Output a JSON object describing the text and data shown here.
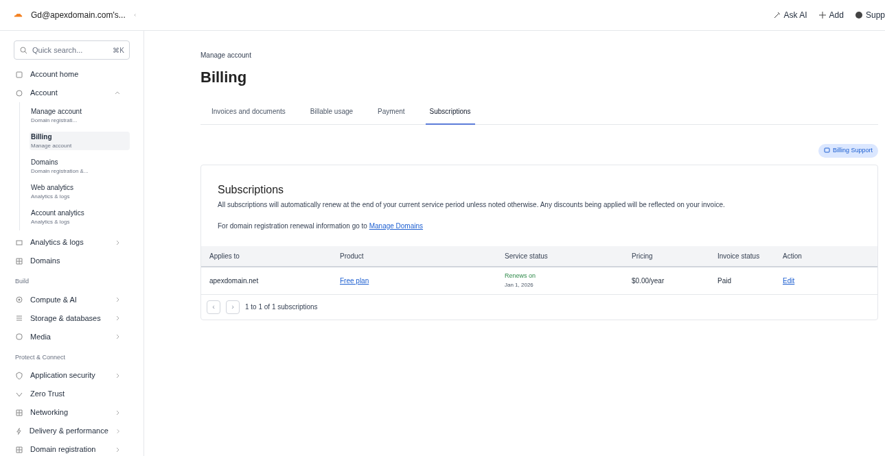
{
  "account": {
    "name": "Gd@apexdomain.com's..."
  },
  "top_actions": [
    {
      "kind": "ai",
      "label": "Ask AI"
    },
    {
      "kind": "add",
      "label": "Add"
    },
    {
      "kind": "support",
      "label": "Supp"
    }
  ],
  "search": {
    "placeholder": "Quick search...",
    "shortcut": "⌘K"
  },
  "sidebar": [
    {
      "kind": "item",
      "label": "Account home"
    },
    {
      "kind": "item",
      "label": "Account",
      "expanded": true,
      "children": [
        {
          "label": "Manage account",
          "sub": "Domain registrati...",
          "selected": false
        },
        {
          "label": "Billing",
          "sub": "Manage account",
          "selected": true
        },
        {
          "label": "Domains",
          "sub": "Domain registration &...",
          "selected": false
        },
        {
          "label": "Web analytics",
          "sub": "Analytics & logs",
          "selected": false
        },
        {
          "label": "Account analytics",
          "sub": "Analytics & logs",
          "selected": false
        }
      ]
    },
    {
      "kind": "item",
      "label": "Analytics & logs",
      "expanded": false
    },
    {
      "kind": "item",
      "label": "Domains"
    },
    {
      "kind": "section",
      "label": "Build"
    },
    {
      "kind": "item",
      "label": "Compute & AI",
      "expanded": false
    },
    {
      "kind": "item",
      "label": "Storage & databases",
      "expanded": false
    },
    {
      "kind": "item",
      "label": "Media",
      "expanded": false
    },
    {
      "kind": "section",
      "label": "Protect & Connect"
    },
    {
      "kind": "item",
      "label": "Application security",
      "expanded": false
    },
    {
      "kind": "item",
      "label": "Zero Trust"
    },
    {
      "kind": "item",
      "label": "Networking",
      "expanded": false
    },
    {
      "kind": "item",
      "label": "Delivery & performance",
      "expanded": false
    },
    {
      "kind": "item",
      "label": "Domain registration",
      "expanded": false
    }
  ],
  "breadcrumb": "Manage account",
  "title": "Billing",
  "tabs": [
    {
      "label": "Invoices and documents",
      "selected": false
    },
    {
      "label": "Billable usage",
      "selected": false
    },
    {
      "label": "Payment",
      "selected": false
    },
    {
      "label": "Subscriptions",
      "selected": true
    }
  ],
  "support_button": "Billing Support",
  "card": {
    "title": "Subscriptions",
    "text": "All subscriptions will automatically renew at the end of your current service period unless noted otherwise. Any discounts being applied will be reflected on your invoice.",
    "note": "For domain registration renewal information go to",
    "note_link": "Manage Domains",
    "columns": [
      "Applies to",
      "Product",
      "Service status",
      "Pricing",
      "Invoice status",
      "Action"
    ],
    "rows": [
      {
        "applies_to": "apexdomain.net",
        "product": "Free plan",
        "status": "Renews on",
        "status_date": "Jan 1, 2026",
        "pricing": "$0.00/year",
        "invoice_status": "Paid",
        "action": "Edit"
      }
    ],
    "pager": {
      "prev": "‹",
      "next": "›",
      "summary": "1 to 1 of 1 subscriptions"
    }
  }
}
